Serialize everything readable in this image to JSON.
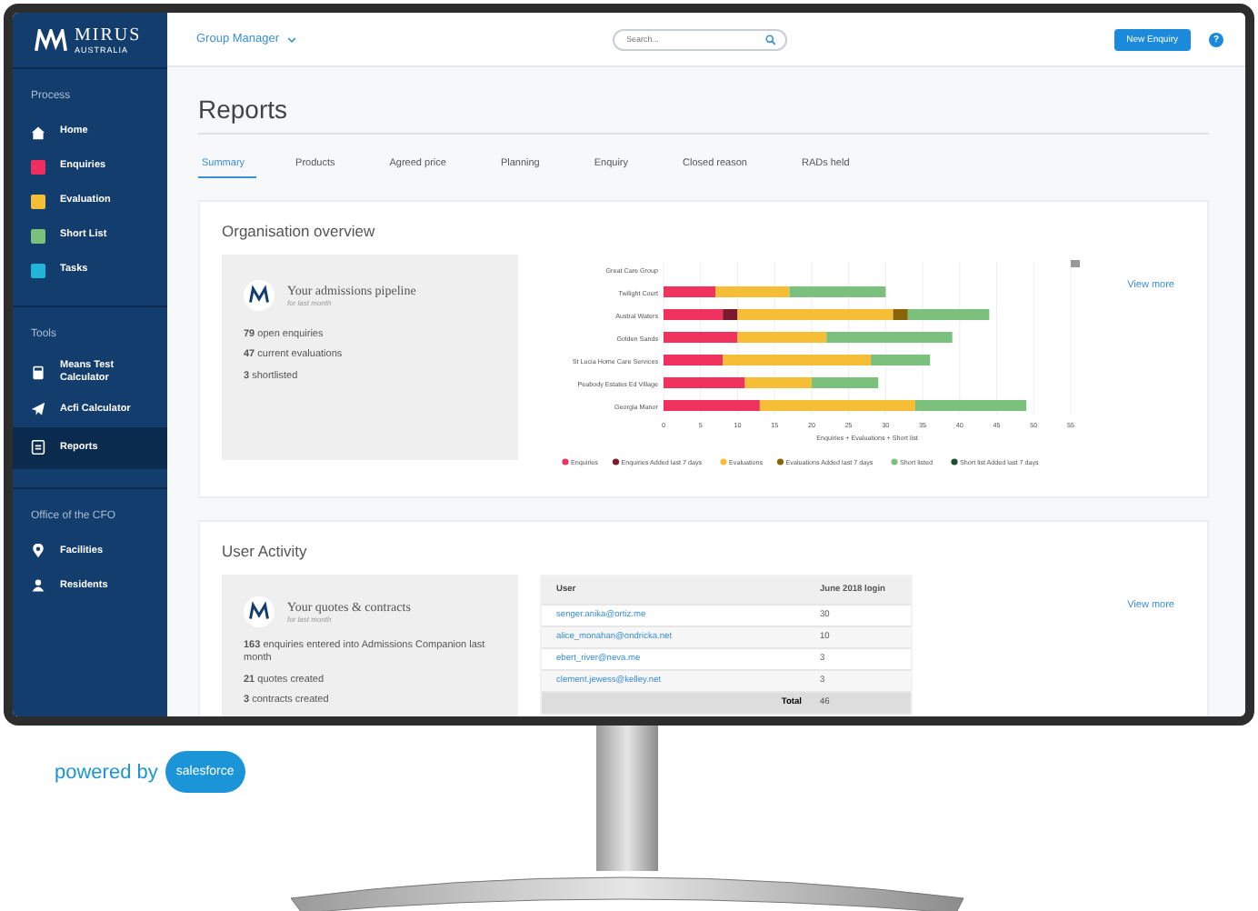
{
  "brand": {
    "name": "MIRUS",
    "tagline": "AUSTRALIA"
  },
  "header": {
    "context": "Group Manager",
    "search": {
      "placeholder": "Search..."
    },
    "primary_button": "New Enquiry",
    "help": "?"
  },
  "sidebar": {
    "sections": [
      {
        "title": "Process",
        "items": [
          {
            "label": "Home",
            "kind": "home",
            "selected": false
          },
          {
            "label": "Enquiries",
            "kind": "swatch",
            "color": "#ef2d5e",
            "selected": false
          },
          {
            "label": "Evaluation",
            "kind": "swatch",
            "color": "#f6be36",
            "selected": false
          },
          {
            "label": "Short List",
            "kind": "swatch",
            "color": "#7cc07e",
            "selected": false
          },
          {
            "label": "Tasks",
            "kind": "swatch",
            "color": "#22b5d8",
            "selected": false
          }
        ]
      },
      {
        "title": "Tools",
        "items": [
          {
            "label": "Means Test Calculator",
            "kind": "calculator",
            "selected": false
          },
          {
            "label": "Acfi Calculator",
            "kind": "plane",
            "selected": false
          },
          {
            "label": "Reports",
            "kind": "report",
            "selected": true
          }
        ]
      },
      {
        "title": "Office of the CFO",
        "items": [
          {
            "label": "Facilities",
            "kind": "pin",
            "selected": false
          },
          {
            "label": "Residents",
            "kind": "people",
            "selected": false
          }
        ]
      }
    ]
  },
  "page": {
    "title": "Reports"
  },
  "tabs": [
    {
      "label": "Summary",
      "selected": true
    },
    {
      "label": "Products",
      "selected": false
    },
    {
      "label": "Agreed price",
      "selected": false
    },
    {
      "label": "Planning",
      "selected": false
    },
    {
      "label": "Enquiry",
      "selected": false
    },
    {
      "label": "Closed reason",
      "selected": false
    },
    {
      "label": "RADs held",
      "selected": false
    }
  ],
  "organisation_overview": {
    "title": "Organisation overview",
    "summary": {
      "title": "Your admissions pipeline",
      "subtitle": "for last month",
      "stats": [
        "**79** open enquiries",
        "**47** current evaluations",
        "**3** shortlisted"
      ]
    },
    "chart_data": {
      "type": "bar",
      "orientation": "horizontal",
      "stacked": true,
      "grid": true,
      "legend": true,
      "xlabel": "Enquiries + Evaluations + Short list",
      "categories": [
        "Great Care Group",
        "Twilight Court",
        "Austral Waters",
        "Golden Sands",
        "St Lucia Home Care Services",
        "Peabody Estates Ed Village",
        "Georgia Manor"
      ],
      "xlim": [
        0,
        55
      ],
      "xticks": [
        0,
        5,
        10,
        15,
        20,
        25,
        30,
        35,
        40,
        45,
        50,
        55
      ],
      "series": [
        {
          "name": "Enquiries",
          "color": "#f0325f",
          "values": [
            null,
            7,
            8,
            10,
            8,
            11,
            13
          ]
        },
        {
          "name": "Enquiries Added last 7 days",
          "color": "#7a1a2e",
          "values": [
            null,
            0,
            2,
            0,
            0,
            0,
            0
          ]
        },
        {
          "name": "Evaluations",
          "color": "#f6be36",
          "values": [
            null,
            10,
            21,
            12,
            20,
            9,
            21
          ]
        },
        {
          "name": "Evaluations Added last 7 days",
          "color": "#8a6508",
          "values": [
            null,
            0,
            2,
            0,
            0,
            0,
            0
          ]
        },
        {
          "name": "Short listed",
          "color": "#7cc07e",
          "values": [
            null,
            13,
            11,
            17,
            8,
            9,
            15
          ]
        },
        {
          "name": "Short list Added last 7 days",
          "color": "#1d4d32",
          "values": [
            null,
            0,
            0,
            0,
            0,
            0,
            0
          ]
        }
      ]
    },
    "link": "View more"
  },
  "user_activity": {
    "title": "User Activity",
    "summary": {
      "title": "Your quotes & contracts",
      "subtitle": "for last month",
      "stats": [
        "**163** enquiries entered into Admissions Companion last month",
        "**21** quotes created",
        "**3** contracts created"
      ]
    },
    "table": {
      "columns": [
        "User",
        "June 2018 login"
      ],
      "rows": [
        [
          "senger.anika@ortiz.me",
          "30"
        ],
        [
          "alice_monahan@ondricka.net",
          "10"
        ],
        [
          "ebert_river@neva.me",
          "3"
        ],
        [
          "clement.jewess@kelley.net",
          "3"
        ]
      ],
      "total_label": "Total",
      "total": "46"
    },
    "link": "View more"
  },
  "footer": {
    "powered_by": "powered by",
    "logo_text": "salesforce"
  }
}
